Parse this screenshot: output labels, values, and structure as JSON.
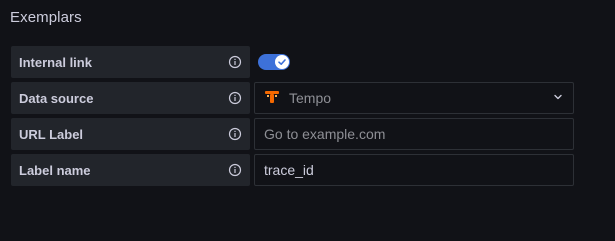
{
  "section": {
    "title": "Exemplars"
  },
  "rows": [
    {
      "label": "Internal link",
      "control": "toggle",
      "checked": true
    },
    {
      "label": "Data source",
      "control": "select",
      "value": "Tempo",
      "icon": "tempo-logo-icon"
    },
    {
      "label": "URL Label",
      "control": "input",
      "placeholder": "Go to example.com"
    },
    {
      "label": "Label name",
      "control": "input",
      "value": "trace_id"
    }
  ],
  "colors": {
    "background": "#111217",
    "label_bg": "#22252b",
    "toggle_on": "#3d71d9",
    "text": "#ccccdc",
    "muted": "#8e8f95",
    "tempo_orange": "#f46800"
  }
}
